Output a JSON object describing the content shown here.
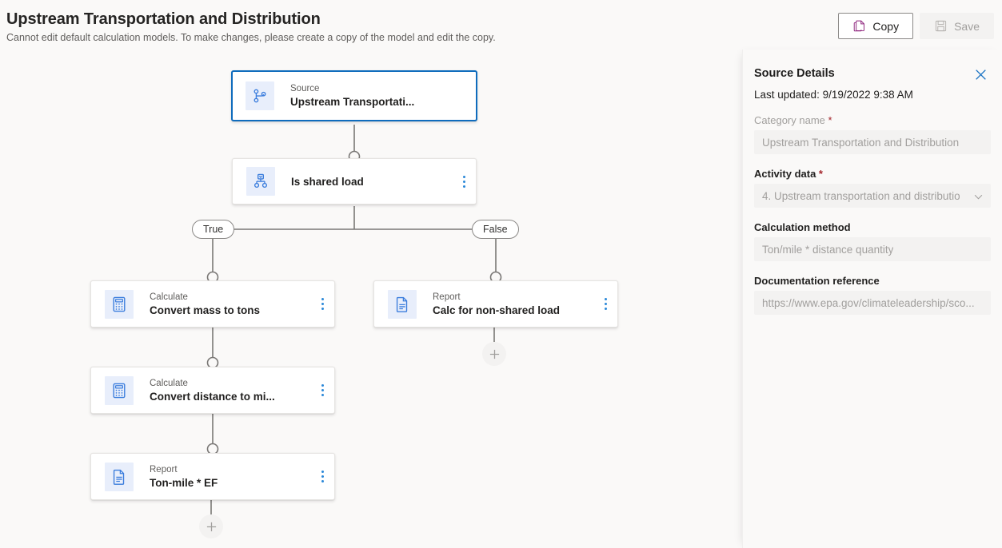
{
  "header": {
    "title": "Upstream Transportation and Distribution",
    "subtitle": "Cannot edit default calculation models. To make changes, please create a copy of the model and edit the copy.",
    "copy_label": "Copy",
    "copy_icon": "copy-icon",
    "save_label": "Save",
    "save_icon": "save-icon",
    "save_disabled": true
  },
  "colors": {
    "accent_blue": "#0f6cbd",
    "icon_blue": "#2b88d8",
    "copy_icon_purple": "#8b1f7a",
    "canvas_bg": "#faf9f8",
    "node_bg": "#ffffff",
    "icon_tile_bg": "#e8eefb",
    "connector_gray": "#797775",
    "required_red": "#a4262c"
  },
  "flow": {
    "nodes": [
      {
        "id": "source",
        "type_label": "Source",
        "name": "Upstream Transportati...",
        "icon": "branch-fork-icon",
        "selected": true,
        "has_menu": false
      },
      {
        "id": "condition",
        "type_label": "",
        "name": "Is shared load",
        "icon": "decision-hierarchy-icon",
        "selected": false,
        "has_menu": true
      },
      {
        "id": "convert-mass",
        "type_label": "Calculate",
        "name": "Convert mass to tons",
        "icon": "calculator-icon",
        "selected": false,
        "has_menu": true
      },
      {
        "id": "convert-distance",
        "type_label": "Calculate",
        "name": "Convert distance to mi...",
        "icon": "calculator-icon",
        "selected": false,
        "has_menu": true
      },
      {
        "id": "report-tonmile",
        "type_label": "Report",
        "name": "Ton-mile * EF",
        "icon": "report-document-icon",
        "selected": false,
        "has_menu": true
      },
      {
        "id": "report-nonshared",
        "type_label": "Report",
        "name": "Calc for non-shared load",
        "icon": "report-document-icon",
        "selected": false,
        "has_menu": true
      }
    ],
    "branch_true_label": "True",
    "branch_false_label": "False",
    "add_button_label": "+"
  },
  "panel": {
    "title": "Source Details",
    "close_icon": "close-icon",
    "last_updated": "Last updated: 9/19/2022 9:38 AM",
    "fields": [
      {
        "label": "Category name",
        "required": true,
        "label_strong": false,
        "value": "Upstream Transportation and Distribution",
        "control": "text"
      },
      {
        "label": "Activity data",
        "required": true,
        "label_strong": true,
        "value": "4. Upstream transportation and distributio",
        "control": "dropdown"
      },
      {
        "label": "Calculation method",
        "required": false,
        "label_strong": true,
        "value": "Ton/mile * distance quantity",
        "control": "text"
      },
      {
        "label": "Documentation reference",
        "required": false,
        "label_strong": true,
        "value": "https://www.epa.gov/climateleadership/sco...",
        "control": "text"
      }
    ]
  }
}
